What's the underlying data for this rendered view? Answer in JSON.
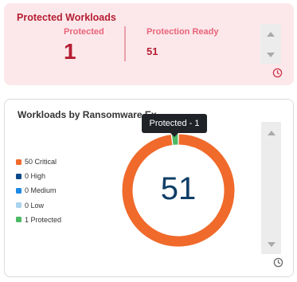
{
  "protected_workloads": {
    "title": "Protected Workloads",
    "protected_label": "Protected",
    "protected_value": "1",
    "ready_label": "Protection Ready",
    "ready_value": "51"
  },
  "ransomware_card": {
    "title": "Workloads by Ransomware Ex",
    "tooltip": "Protected - 1",
    "center_value": "51",
    "legend": [
      {
        "label": "50 Critical",
        "color": "#f06a2b"
      },
      {
        "label": "0 High",
        "color": "#0b4a8a"
      },
      {
        "label": "0 Medium",
        "color": "#1e88e5"
      },
      {
        "label": "0 Low",
        "color": "#a9d3ee"
      },
      {
        "label": "1 Protected",
        "color": "#4cb963"
      }
    ]
  },
  "chart_data": {
    "type": "pie",
    "categories": [
      "Critical",
      "High",
      "Medium",
      "Low",
      "Protected"
    ],
    "values": [
      50,
      0,
      0,
      0,
      1
    ],
    "colors": [
      "#f06a2b",
      "#0b4a8a",
      "#1e88e5",
      "#a9d3ee",
      "#4cb963"
    ]
  },
  "colors": {
    "alert_bg": "#fce8ea",
    "alert_text": "#b51d33",
    "alert_label": "#e8637a",
    "center_value": "#0e3e66"
  },
  "icons": {
    "card1_footer": "clock-icon",
    "card2_footer": "clock-icon",
    "scroll_up": "arrow-up-icon",
    "scroll_down": "arrow-down-icon"
  }
}
